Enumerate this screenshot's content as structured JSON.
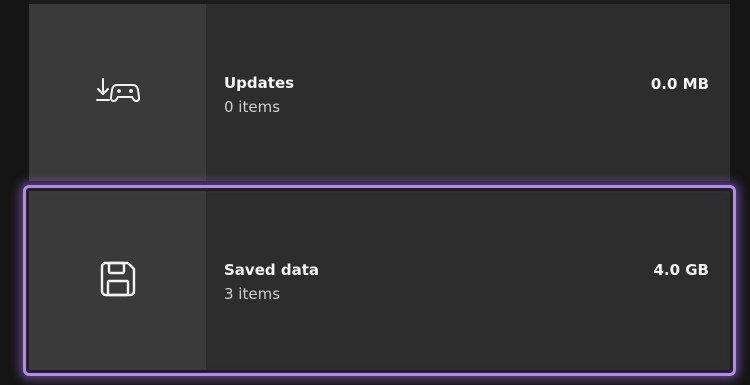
{
  "storage_list": {
    "items": [
      {
        "title": "Updates",
        "subtitle": "0 items",
        "size": "0.0 MB",
        "icon": "download-controller-icon"
      },
      {
        "title": "Saved data",
        "subtitle": "3 items",
        "size": "4.0 GB",
        "icon": "save-floppy-icon",
        "focused": true
      }
    ]
  },
  "colors": {
    "background": "#151515",
    "row": "#2d2d2d",
    "icon_tile": "#3a3a3a",
    "focus": "#b18be6"
  }
}
